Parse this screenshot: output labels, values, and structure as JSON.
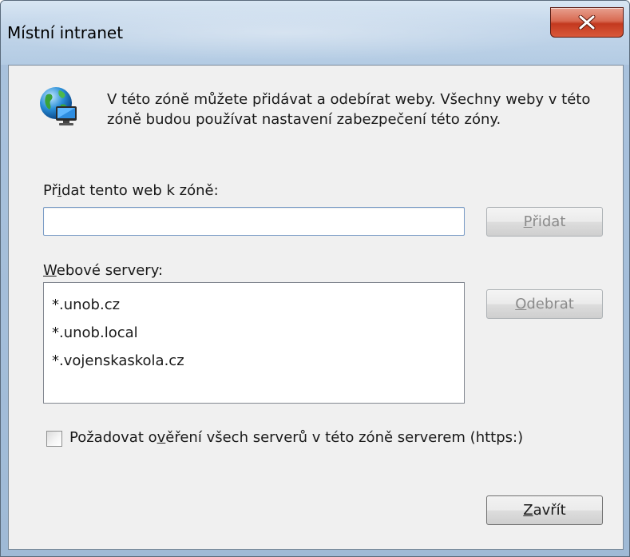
{
  "window": {
    "title": "Místní intranet"
  },
  "intro": {
    "text": "V této zóně můžete přidávat a odebírat weby. Všechny weby v této zóně budou používat nastavení zabezpečení této zóny."
  },
  "add_section": {
    "label_pre": "Př",
    "label_key": "i",
    "label_post": "dat tento web k zóně:",
    "input_value": "",
    "add_button_key": "P",
    "add_button_rest": "řidat"
  },
  "servers": {
    "label_key": "W",
    "label_rest": "ebové servery:",
    "items": [
      "*.unob.cz",
      "*.unob.local",
      "*.vojenskaskola.cz"
    ],
    "remove_button_key": "O",
    "remove_button_rest": "debrat"
  },
  "https_option": {
    "checked": false,
    "label_pre": "Požadovat o",
    "label_key": "v",
    "label_post": "ěření všech serverů v této zóně serverem (https:)"
  },
  "close_button": {
    "key": "Z",
    "rest": "avřít"
  },
  "icons": {
    "zone": "globe-computer-icon",
    "close": "close-icon"
  }
}
